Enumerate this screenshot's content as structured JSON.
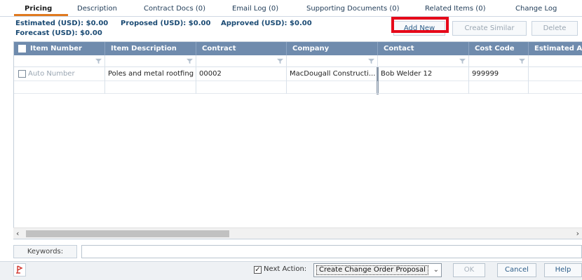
{
  "tabs": [
    {
      "label": "Pricing",
      "active": true
    },
    {
      "label": "Description"
    },
    {
      "label": "Contract Docs (0)"
    },
    {
      "label": "Email Log (0)"
    },
    {
      "label": "Supporting Documents (0)"
    },
    {
      "label": "Related Items (0)"
    },
    {
      "label": "Change Log"
    }
  ],
  "totals": {
    "estimated": "Estimated (USD): $0.00",
    "proposed": "Proposed (USD): $0.00",
    "approved": "Approved (USD): $0.00",
    "forecast": "Forecast (USD): $0.00"
  },
  "toolbar": {
    "add_new": "Add New",
    "create_similar": "Create Similar",
    "delete": "Delete"
  },
  "grid": {
    "columns": [
      "Item Number",
      "Item Description",
      "Contract",
      "Company",
      "Contact",
      "Cost Code",
      "Estimated Am"
    ],
    "row": {
      "item_number": "Auto Number",
      "item_description": "Poles and metal rootfing",
      "contract": "00002",
      "company": "MacDougall Constructi...",
      "contact": "Bob Welder 12",
      "cost_code": "999999"
    }
  },
  "keywords": {
    "label": "Keywords:",
    "value": ""
  },
  "footer": {
    "next_action_label": "Next Action:",
    "next_action_checked": true,
    "next_action_value": "Create Change Order Proposal",
    "ok": "OK",
    "cancel": "Cancel",
    "help": "Help"
  },
  "colors": {
    "header_bg": "#6f8bad",
    "tab_accent": "#e07a1f",
    "highlight": "#e6091a",
    "totals_text": "#1a4a73"
  }
}
